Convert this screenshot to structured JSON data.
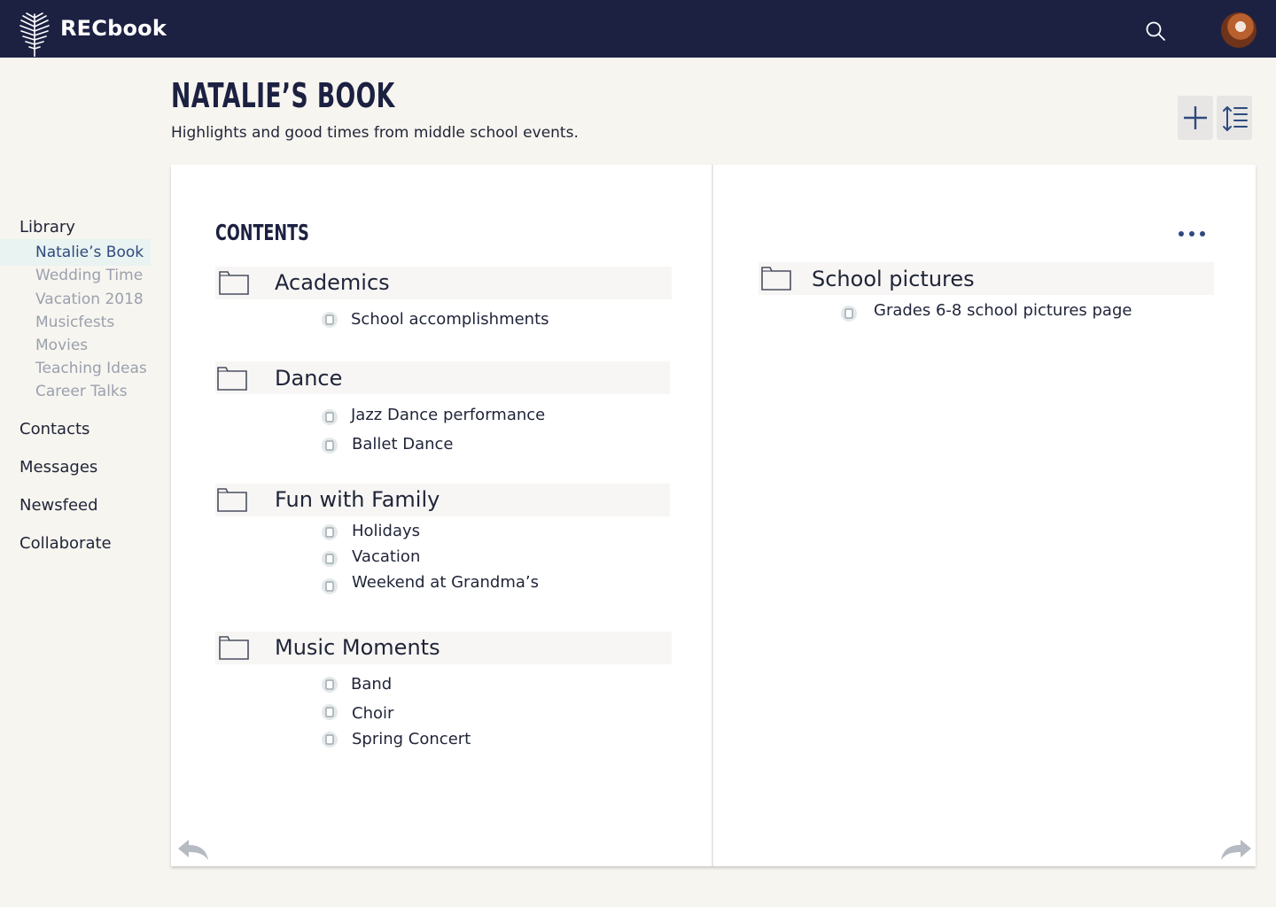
{
  "app": {
    "name": "RECbook"
  },
  "header": {
    "title": "NATALIE’S BOOK",
    "subtitle": "Highlights and good times from middle school events."
  },
  "sidebar": {
    "library_label": "Library",
    "books": [
      "Natalie’s Book",
      "Wedding Time",
      "Vacation 2018",
      "Musicfests",
      "Movies",
      "Teaching Ideas",
      "Career Talks"
    ],
    "active_book": "Natalie’s Book",
    "links": [
      "Contacts",
      "Messages",
      "Newsfeed",
      "Collaborate"
    ]
  },
  "book": {
    "contents_title": "CONTENTS",
    "sections": [
      {
        "title": "Academics",
        "items": [
          "School accomplishments"
        ]
      },
      {
        "title": "Dance",
        "items": [
          "Jazz Dance performance",
          "Ballet Dance"
        ]
      },
      {
        "title": "Fun with Family",
        "items": [
          "Holidays",
          "Vacation",
          "Weekend at Grandma’s"
        ]
      },
      {
        "title": "Music Moments",
        "items": [
          "Band",
          "Choir",
          "Spring Concert"
        ]
      }
    ],
    "right_sections": [
      {
        "title": "School pictures",
        "items": [
          "Grades 6-8 school pictures page"
        ]
      }
    ]
  },
  "icons": {
    "logo": "palm-leaf-logo",
    "search": "search-icon",
    "add": "plus-icon",
    "sort": "line-spacing-icon",
    "folder": "folder-icon",
    "page": "page-icon",
    "more": "more-dots-icon",
    "prev": "back-arrow-icon",
    "next": "forward-arrow-icon"
  },
  "colors": {
    "topbar": "#1c2142",
    "accent": "#2f4a7e",
    "page_background": "#f7f5ef",
    "muted_text": "#9aa0ae"
  }
}
